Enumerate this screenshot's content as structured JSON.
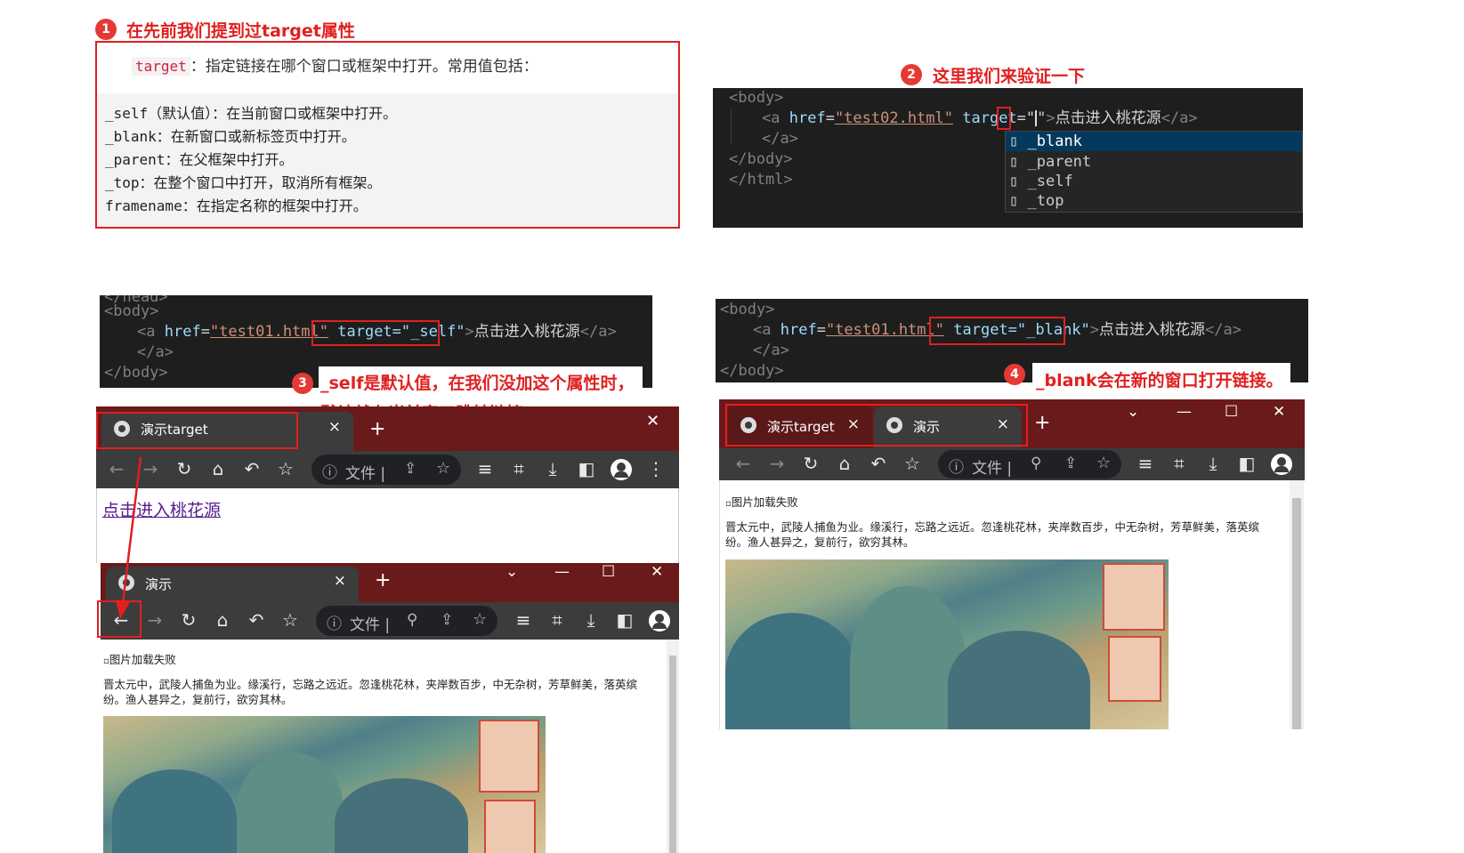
{
  "colors": {
    "accent_red": "#e02020",
    "editor_bg": "#1e1e1e",
    "chrome_frame": "#6a1a1a",
    "toolbar": "#3c3c3c"
  },
  "annotations": [
    {
      "num": "1",
      "text": "在先前我们提到过target属性"
    },
    {
      "num": "2",
      "text": "这里我们来验证一下"
    },
    {
      "num": "3",
      "text_line1": "_self是默认值，在我们没加这个属性时，",
      "text_line2": "默认就在当前窗口跳转链接。"
    },
    {
      "num": "4",
      "text": "_blank会在新的窗口打开链接。"
    }
  ],
  "doc": {
    "target_code": "target",
    "target_desc": "：指定链接在哪个窗口或框架中打开。常用值包括：",
    "values": [
      {
        "name": "_self",
        "desc": "（默认值）：在当前窗口或框架中打开。"
      },
      {
        "name": "_blank",
        "desc": "：在新窗口或新标签页中打开。"
      },
      {
        "name": "_parent",
        "desc": "：在父框架中打开。"
      },
      {
        "name": "_top",
        "desc": "：在整个窗口中打开，取消所有框架。"
      },
      {
        "name": "framename",
        "desc": "：在指定名称的框架中打开。"
      }
    ]
  },
  "editor2": {
    "line1": "<body>",
    "a_open": "<a",
    "href_attr": "href",
    "href_val": "\"test02.html\"",
    "target_attr": "target",
    "target_val": "=\"",
    "link_text": "点击进入桃花源",
    "a_close": "</a>",
    "line3": "</a>",
    "line4": "</body>",
    "line5": "</html>",
    "suggestions": [
      "_blank",
      "_parent",
      "_self",
      "_top"
    ]
  },
  "editor3": {
    "line0": "</head>",
    "line1": "<body>",
    "href_val": "\"test01.html\"",
    "target_text": "target=\"_self\"",
    "link_text": "点击进入桃花源",
    "line3": "</a>",
    "line4": "</body>"
  },
  "editor4": {
    "line1": "<body>",
    "href_val": "\"test01.html\"",
    "target_text": "target=\"_blank\"",
    "link_text": "点击进入桃花源",
    "line3": "</a>",
    "line4": "</body>"
  },
  "browser_self_top": {
    "tab_title": "演示target",
    "tab_close": "×",
    "new_tab": "+",
    "address": "文件 |",
    "page_link": "点击进入桃花源"
  },
  "browser_self_bottom": {
    "tab_title": "演示",
    "tab_close": "×",
    "new_tab": "+",
    "address": "文件 |",
    "img_alt": "图片加载失败",
    "paragraph": "晋太元中，武陵人捕鱼为业。缘溪行，忘路之远近。忽逢桃花林，夹岸数百步，中无杂树，芳草鲜美，落英缤纷。渔人甚异之，复前行，欲穷其林。"
  },
  "browser_blank": {
    "tab1_title": "演示target",
    "tab2_title": "演示",
    "tab_close": "×",
    "new_tab": "+",
    "address": "文件 |",
    "img_alt": "图片加载失败",
    "paragraph": "晋太元中，武陵人捕鱼为业。缘溪行，忘路之远近。忽逢桃花林，夹岸数百步，中无杂树，芳草鲜美，落英缤纷。渔人甚异之，复前行，欲穷其林。"
  },
  "icons": [
    "info-icon",
    "back-arrow-icon",
    "forward-arrow-icon",
    "reload-icon",
    "home-icon",
    "undo-icon",
    "star-icon",
    "share-icon",
    "zoom-icon",
    "reading-list-icon",
    "crop-icon",
    "download-icon",
    "sidepanel-icon",
    "profile-icon",
    "more-icon",
    "globe-icon",
    "minimize-icon",
    "maximize-icon",
    "close-icon",
    "chevron-down-icon"
  ]
}
